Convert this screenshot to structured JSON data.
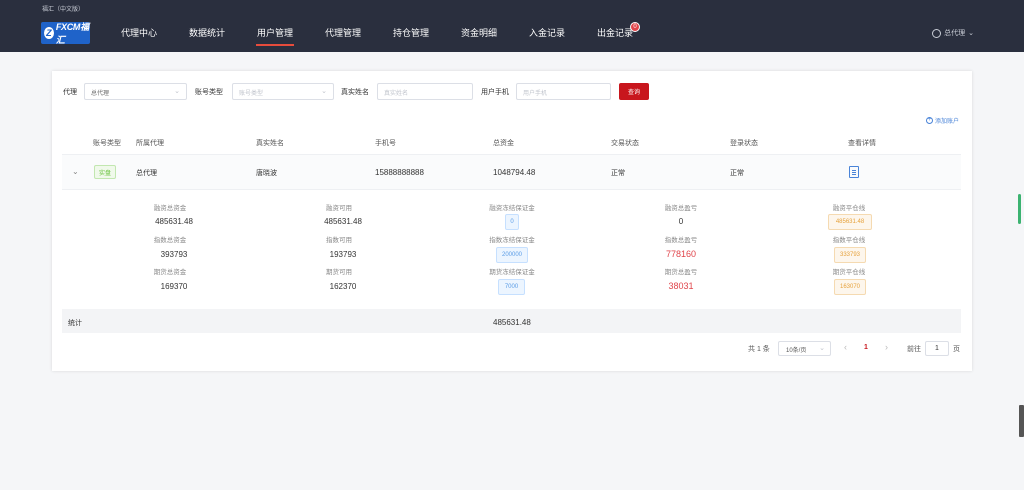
{
  "header": {
    "top_text": "福汇（中文版）",
    "logo_text": "FXCM福汇",
    "nav": [
      "代理中心",
      "数据统计",
      "用户管理",
      "代理管理",
      "持仓管理",
      "资金明细",
      "入金记录",
      "出金记录"
    ],
    "active_nav": "用户管理",
    "withdraw_badge": "0",
    "user_label": "总代理"
  },
  "filters": {
    "agent_label": "代理",
    "agent_value": "总代理",
    "account_type_label": "账号类型",
    "account_type_placeholder": "账号类型",
    "real_name_label": "真实姓名",
    "real_name_placeholder": "真实姓名",
    "phone_label": "用户手机",
    "phone_placeholder": "用户手机",
    "query_button": "查询",
    "add_account": "添加账户"
  },
  "table": {
    "headers": [
      "账号类型",
      "所属代理",
      "真实姓名",
      "手机号",
      "总资金",
      "交易状态",
      "登录状态",
      "查看详情"
    ],
    "row": {
      "type": "实盘",
      "agent": "总代理",
      "name": "唐晓波",
      "phone": "15888888888",
      "total": "1048794.48",
      "trade_status": "正常",
      "login_status": "正常"
    },
    "details": [
      {
        "l1": "融资总资金",
        "v1": "485631.48",
        "l2": "融资可用",
        "v2": "485631.48",
        "l3": "融资冻结保证金",
        "v3": "0",
        "l4": "融资总盈亏",
        "v4": "0",
        "l5": "融资平仓线",
        "v5": "485631.48"
      },
      {
        "l1": "指数总资金",
        "v1": "393793",
        "l2": "指数可用",
        "v2": "193793",
        "l3": "指数冻结保证金",
        "v3": "200000",
        "l4": "指数总盈亏",
        "v4": "778160",
        "l5": "指数平仓线",
        "v5": "333793"
      },
      {
        "l1": "期货总资金",
        "v1": "169370",
        "l2": "期货可用",
        "v2": "162370",
        "l3": "期货冻结保证金",
        "v3": "7000",
        "l4": "期货总盈亏",
        "v4": "38031",
        "l5": "期货平仓线",
        "v5": "163070"
      }
    ],
    "sum_label": "统计",
    "sum_value": "485631.48"
  },
  "pagination": {
    "total": "共 1 条",
    "page_size": "10条/页",
    "current": "1",
    "goto_prefix": "前往",
    "goto_value": "1",
    "goto_suffix": "页"
  }
}
